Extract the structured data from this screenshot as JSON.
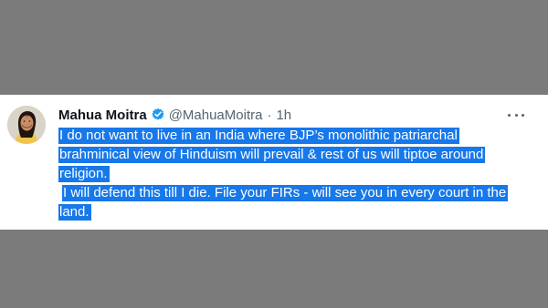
{
  "tweet": {
    "author": {
      "display_name": "Mahua Moitra",
      "handle": "@MahuaMoitra",
      "separator": "·",
      "time": "1h",
      "verified_icon": "verified-badge-icon",
      "avatar": "profile-avatar"
    },
    "more_icon": "more-options-icon",
    "text_lines": [
      "I do not want to live in an India where BJP’s monolithic patriarchal",
      "brahminical view of Hinduism will prevail & rest of us will tiptoe around",
      "religion.",
      "I will defend this till I die. File your FIRs - will see you in every court in the",
      "land."
    ]
  },
  "colors": {
    "page_background": "#7b7b7b",
    "card_background": "#ffffff",
    "highlight": "#1778ea",
    "verified_blue": "#1d9bf0",
    "secondary_text": "#536471"
  }
}
